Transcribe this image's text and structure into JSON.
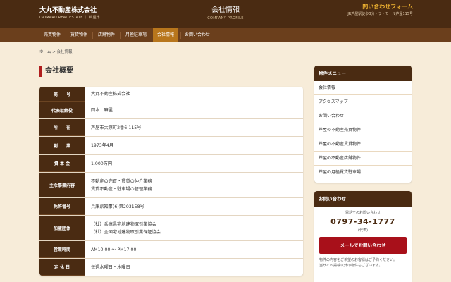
{
  "header": {
    "company_name": "大丸不動産株式会社",
    "company_sub": "DAIMARU REAL ESTATE ｜ 芦屋市",
    "page_title": "会社情報",
    "page_title_en": "COMPANY PROFILE",
    "contact_small": "",
    "contact_form": "問い合わせフォーム",
    "address": "JR芦屋駅徒歩3分・ラ・モール芦屋115号"
  },
  "nav": [
    "売買物件",
    "賃貸物件",
    "店舗物件",
    "月極駐車場",
    "会社情報",
    "お問い合わせ"
  ],
  "nav_active": "会社情報",
  "breadcrumb": {
    "home": "ホーム",
    "sep": ">",
    "current": "会社情報"
  },
  "heading": "会社概要",
  "table": [
    {
      "label": "商　　号",
      "lines": [
        "大丸不動産株式会社"
      ]
    },
    {
      "label": "代表取締役",
      "lines": [
        "岡本　麻里"
      ]
    },
    {
      "label": "所　　在",
      "lines": [
        "芦屋市大原町2番6-115号"
      ]
    },
    {
      "label": "創　　業",
      "lines": [
        "1973年4月"
      ]
    },
    {
      "label": "資 本 金",
      "lines": [
        "1,000万円"
      ]
    },
    {
      "label": "主な事業内容",
      "lines": [
        "不動産の売買・賃貸の仲介業務",
        "賃貸不動産・駐車場の管理業務"
      ]
    },
    {
      "label": "免許番号",
      "lines": [
        "兵庫県知事(6)第203158号"
      ]
    },
    {
      "label": "加盟団体",
      "lines": [
        "（社）兵庫県宅地建物取引業協会",
        "（社）全国宅地建物取引業保証協会"
      ]
    },
    {
      "label": "営業時間",
      "lines": [
        "AM10:00 〜 PM17:00"
      ]
    },
    {
      "label": "定 休 日",
      "lines": [
        "毎週水曜日・木曜日"
      ]
    }
  ],
  "sidebar": {
    "menu_title": "物件メニュー",
    "menu_items": [
      "会社情報",
      "アクセスマップ",
      "お問い合わせ",
      "芦屋の不動産売買物件",
      "芦屋の不動産賃貸物件",
      "芦屋の不動産店舗物件",
      "芦屋の月極賃貸駐車場"
    ],
    "contact_title": "お問い合わせ",
    "contact_label": "電話でのお問い合わせ",
    "phone": "0797-34-1777",
    "phone_note": "(代表)",
    "mail_button": "メールでお問い合わせ",
    "footer_line1": "物件の内容をご希望のお客様はご予約ください。",
    "footer_line2": "当サイト掲載以外の物件もございます。"
  }
}
